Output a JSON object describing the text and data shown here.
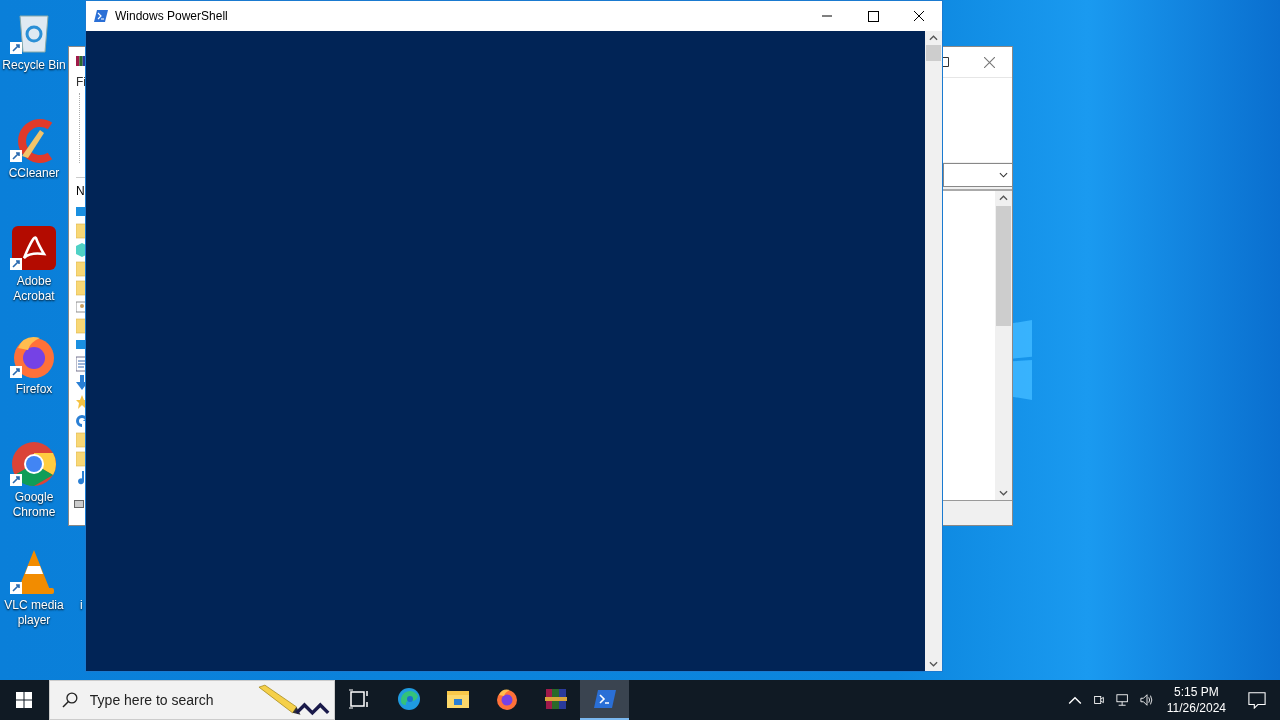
{
  "desktop_icons": [
    {
      "kind": "recycle",
      "label": "Recycle Bin"
    },
    {
      "kind": "ccleaner",
      "label": "CCleaner"
    },
    {
      "kind": "acrobat",
      "label": "Adobe Acrobat"
    },
    {
      "kind": "firefox",
      "label": "Firefox"
    },
    {
      "kind": "chrome",
      "label": "Google Chrome"
    },
    {
      "kind": "vlc",
      "label": "VLC media player"
    }
  ],
  "hidden_icon_label": "i",
  "background_window": {
    "menu_text": "Fi",
    "column_header": "N",
    "files": [
      {
        "kind": "desktop"
      },
      {
        "kind": "folder"
      },
      {
        "kind": "cube"
      },
      {
        "kind": "folder"
      },
      {
        "kind": "folder"
      },
      {
        "kind": "contact"
      },
      {
        "kind": "folder"
      },
      {
        "kind": "desktop"
      },
      {
        "kind": "document"
      },
      {
        "kind": "download"
      },
      {
        "kind": "star"
      },
      {
        "kind": "link"
      },
      {
        "kind": "folder"
      },
      {
        "kind": "folder"
      },
      {
        "kind": "music"
      }
    ]
  },
  "powershell": {
    "title": "Windows PowerShell"
  },
  "taskbar": {
    "search": {
      "placeholder": "Type here to search"
    },
    "apps": [
      {
        "kind": "taskview",
        "selected": false
      },
      {
        "kind": "edge",
        "selected": false
      },
      {
        "kind": "explorer",
        "selected": false
      },
      {
        "kind": "firefox",
        "selected": false
      },
      {
        "kind": "winrar",
        "selected": false
      },
      {
        "kind": "powershell",
        "selected": true
      }
    ],
    "time": "5:15 PM",
    "date": "11/26/2024"
  }
}
